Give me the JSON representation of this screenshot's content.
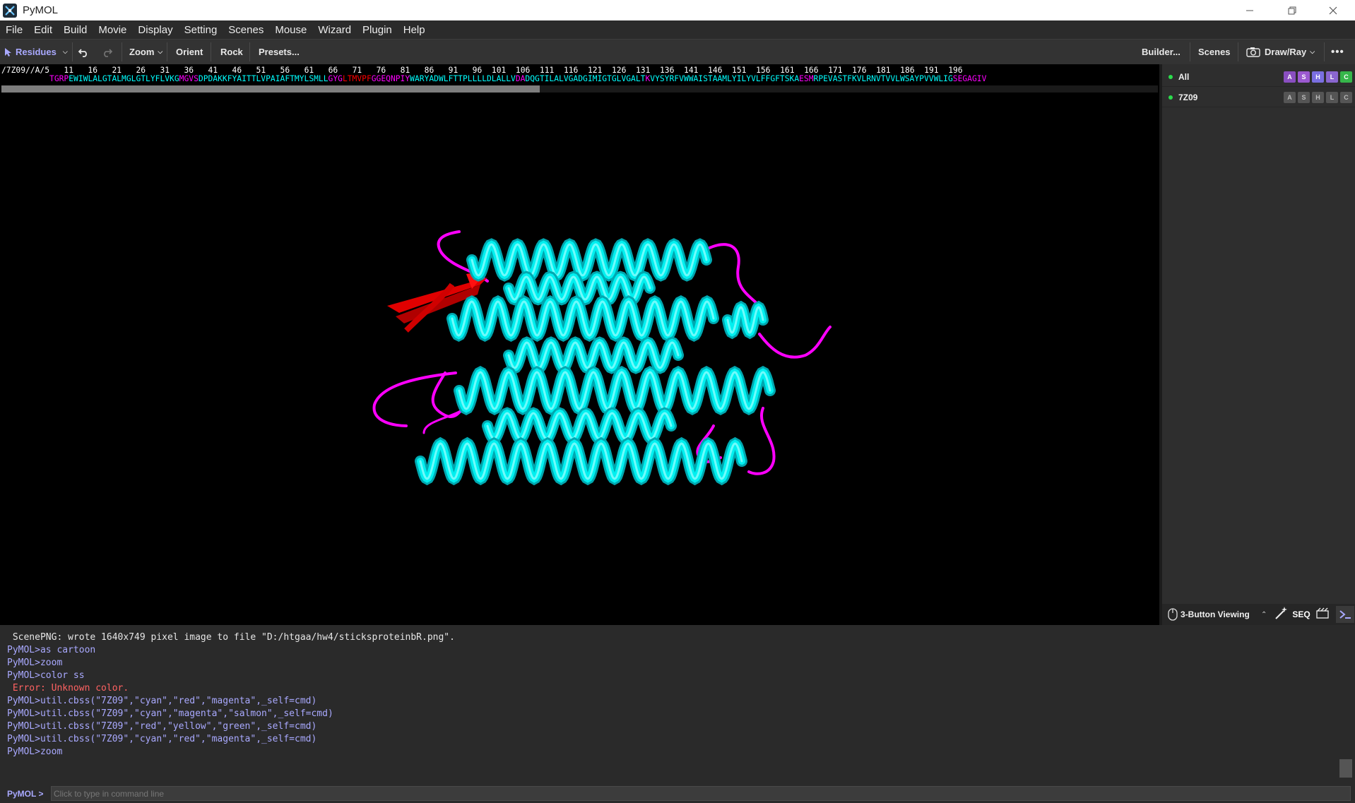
{
  "window": {
    "title": "PyMOL",
    "controls": [
      "minimize-icon",
      "restore-icon",
      "close-icon"
    ]
  },
  "menubar": {
    "items": [
      "File",
      "Edit",
      "Build",
      "Movie",
      "Display",
      "Setting",
      "Scenes",
      "Mouse",
      "Wizard",
      "Plugin",
      "Help"
    ]
  },
  "toolbar": {
    "residues_label": "Residues",
    "zoom_label": "Zoom",
    "orient_label": "Orient",
    "rock_label": "Rock",
    "presets_label": "Presets...",
    "builder_label": "Builder...",
    "scenes_label": "Scenes",
    "drawray_label": "Draw/Ray",
    "more_label": "•••"
  },
  "sequence": {
    "chain_label": "/7Z09//A/5",
    "numbers": [
      "11",
      "16",
      "21",
      "26",
      "31",
      "36",
      "41",
      "46",
      "51",
      "56",
      "61",
      "66",
      "71",
      "76",
      "81",
      "86",
      "91",
      "96",
      "101",
      "106",
      "111",
      "116",
      "121",
      "126",
      "131",
      "136",
      "141",
      "146",
      "151",
      "156",
      "161",
      "166",
      "171",
      "176",
      "181",
      "186",
      "191",
      "196"
    ],
    "segments": [
      {
        "text": "TGRP",
        "color": "#ff00ff"
      },
      {
        "text": "EWIWLALGTALMGLGTLYFLVKG",
        "color": "#00ffff"
      },
      {
        "text": "MGVS",
        "color": "#ff00ff"
      },
      {
        "text": "DPDAKKFYAITTLVPAIAFTMYLSMLL",
        "color": "#00ffff"
      },
      {
        "text": "GYG",
        "color": "#ff00ff"
      },
      {
        "text": "LTMVPF",
        "color": "#ff0000"
      },
      {
        "text": "GGEQNPIY",
        "color": "#ff00ff"
      },
      {
        "text": "WARYADWLFTTPLLLLDLALLV",
        "color": "#00ffff"
      },
      {
        "text": "DA",
        "color": "#ff00ff"
      },
      {
        "text": "DQGTILALVGADGIMIGTGLVGALT",
        "color": "#00ffff"
      },
      {
        "text": "K",
        "color": "#ff00ff"
      },
      {
        "text": "VYSYRFVWWAISTAAMLYILYVLFFGFTSKA",
        "color": "#00ffff"
      },
      {
        "text": "ESM",
        "color": "#ff00ff"
      },
      {
        "text": "RPEVASTFKVLRNVTVVLWSAYPVVWLIG",
        "color": "#00ffff"
      },
      {
        "text": "SEGAGIV",
        "color": "#ff00ff"
      }
    ]
  },
  "objects": [
    {
      "name": "All",
      "buttons": [
        "A",
        "S",
        "H",
        "L",
        "C"
      ]
    },
    {
      "name": "7Z09",
      "buttons": [
        "A",
        "S",
        "H",
        "L",
        "C"
      ]
    }
  ],
  "colors": {
    "btn_A": "#8a4fc0",
    "btn_S": "#9b59d0",
    "btn_H": "#7a6fe0",
    "btn_L": "#8a66d0",
    "btn_C": "#36b64a",
    "helix": "#00ffff",
    "sheet": "#ff0000",
    "loop": "#ff00ff",
    "accent": "#a9a9ff"
  },
  "bottom_panel": {
    "mouse_mode": "3-Button Viewing",
    "seq_label": "SEQ"
  },
  "console": {
    "lines": [
      {
        "type": "out",
        "text": " ScenePNG: wrote 1640x749 pixel image to file \"D:/htgaa/hw4/sticksproteinbR.png\"."
      },
      {
        "type": "cmd",
        "text": "PyMOL>as cartoon"
      },
      {
        "type": "cmd",
        "text": "PyMOL>zoom"
      },
      {
        "type": "cmd",
        "text": "PyMOL>color ss"
      },
      {
        "type": "err",
        "text": " Error: Unknown color."
      },
      {
        "type": "cmd",
        "text": "PyMOL>util.cbss(\"7Z09\",\"cyan\",\"red\",\"magenta\",_self=cmd)"
      },
      {
        "type": "cmd",
        "text": "PyMOL>util.cbss(\"7Z09\",\"cyan\",\"magenta\",\"salmon\",_self=cmd)"
      },
      {
        "type": "cmd",
        "text": "PyMOL>util.cbss(\"7Z09\",\"red\",\"yellow\",\"green\",_self=cmd)"
      },
      {
        "type": "cmd",
        "text": "PyMOL>util.cbss(\"7Z09\",\"cyan\",\"red\",\"magenta\",_self=cmd)"
      },
      {
        "type": "cmd",
        "text": "PyMOL>zoom"
      }
    ]
  },
  "cmdline": {
    "prompt": "PyMOL >",
    "placeholder": "Click to type in command line"
  }
}
